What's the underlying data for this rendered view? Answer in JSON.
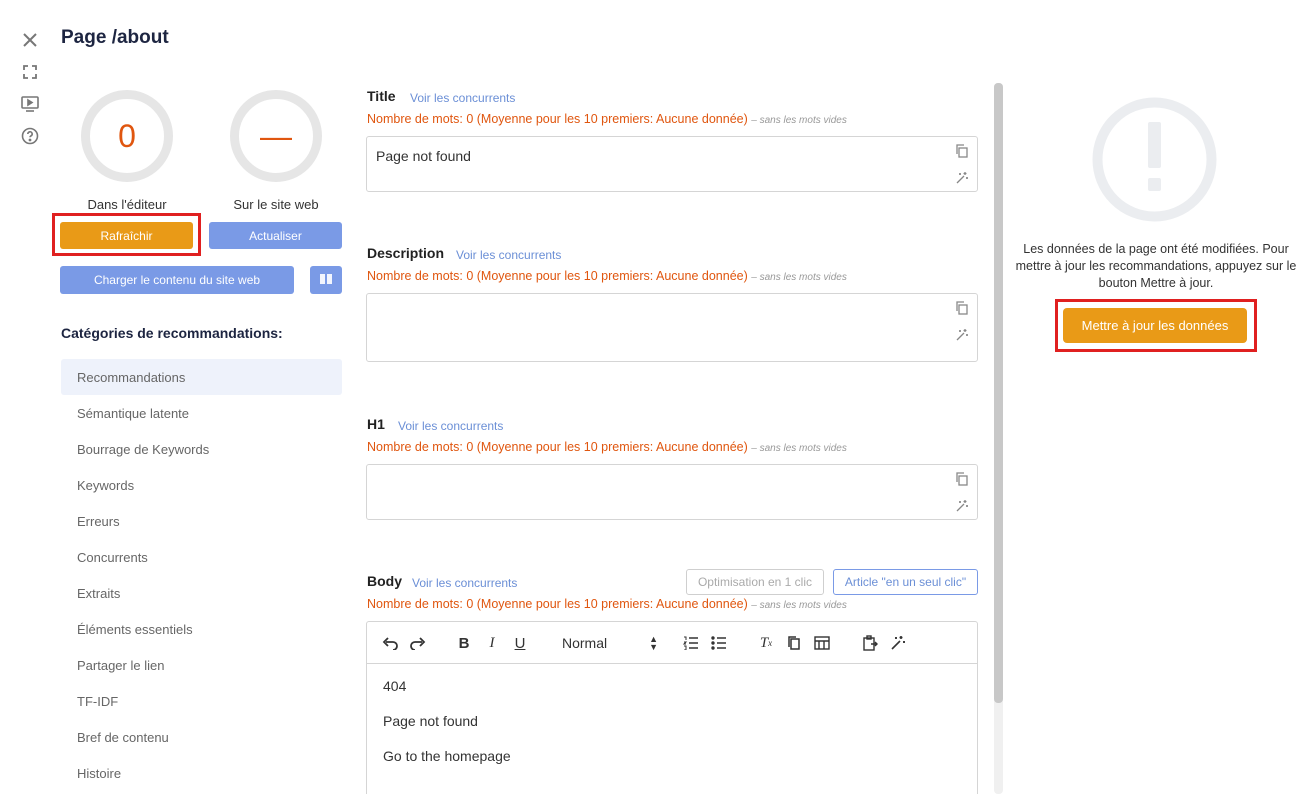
{
  "page": {
    "title": "Page /about"
  },
  "rail": {
    "close_icon": "close-icon",
    "fullscreen_icon": "fullscreen-icon",
    "video_icon": "video-icon",
    "help_icon": "help-icon"
  },
  "scores": {
    "editor": {
      "value": "0",
      "label": "Dans l'éditeur"
    },
    "site": {
      "value": "—",
      "label": "Sur le site web"
    }
  },
  "buttons": {
    "refresh": "Rafraîchir",
    "update": "Actualiser",
    "load_site": "Charger le contenu du site web",
    "update_data": "Mettre à jour les données",
    "one_click_opt": "Optimisation en 1 clic",
    "one_click_article": "Article \"en un seul clic\""
  },
  "categories": {
    "heading": "Catégories de recommandations:",
    "items": [
      "Recommandations",
      "Sémantique latente",
      "Bourrage de Keywords",
      "Keywords",
      "Erreurs",
      "Concurrents",
      "Extraits",
      "Éléments essentiels",
      "Partager le lien",
      "TF-IDF",
      "Bref de contenu",
      "Histoire"
    ]
  },
  "fields": {
    "see_competitors": "Voir les concurrents",
    "count_text": "Nombre de mots: 0 (Moyenne pour les 10 premiers: Aucune donnée)",
    "count_note": "– sans les mots vides",
    "title": {
      "label": "Title",
      "value": "Page not found"
    },
    "description": {
      "label": "Description",
      "value": ""
    },
    "h1": {
      "label": "H1",
      "value": ""
    },
    "body": {
      "label": "Body"
    }
  },
  "editor": {
    "format_select": "Normal",
    "lines": [
      "404",
      "Page not found",
      "Go to the homepage"
    ]
  },
  "right_panel": {
    "message": "Les données de la page ont été modifiées. Pour mettre à jour les recommandations, appuyez sur le bouton Mettre à jour."
  },
  "colors": {
    "accent_orange": "#e99a17",
    "accent_blue": "#7a9ae6",
    "warning_text": "#e0560f",
    "highlight_red": "#e02020",
    "title_navy": "#1d2541"
  }
}
